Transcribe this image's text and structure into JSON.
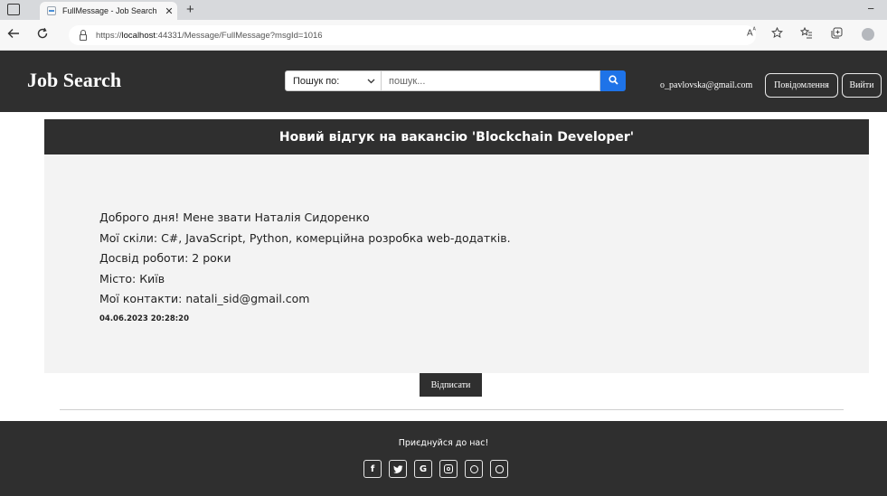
{
  "browser": {
    "tab_title": "FullMessage - Job Search",
    "tab_close": "✕",
    "new_tab": "+",
    "minimize": "−",
    "url_prefix": "https://",
    "url_host": "localhost",
    "url_rest": ":44331/Message/FullMessage?msgId=1016"
  },
  "header": {
    "brand": "Job Search",
    "search_select": "Пошук по:",
    "search_placeholder": "пошук...",
    "user_email": "o_pavlovska@gmail.com",
    "messages_button": "Повідомлення",
    "logout_button": "Вийти"
  },
  "message": {
    "title": "Новий відгук на вакансію 'Blockchain Developer'",
    "lines": [
      "Доброго дня! Мене звати Наталія Сидоренко",
      "Мої скіли: C#, JavaScript, Python, комерційна розробка web-додатків.",
      "Досвід роботи: 2 роки",
      "Місто: Київ",
      "Мої контакти: natali_sid@gmail.com"
    ],
    "date": "04.06.2023 20:28:20",
    "unsubscribe_button": "Відписати"
  },
  "footer": {
    "join_text": "Приєднуйся до нас!",
    "socials": [
      "facebook-icon",
      "twitter-icon",
      "google-icon",
      "instagram-icon",
      "whatsapp-icon",
      "skype-icon"
    ],
    "facebook_glyph": "f",
    "google_glyph": "G"
  },
  "colors": {
    "dark": "#2f2f2f",
    "card_body": "#f3f3f3",
    "search_button": "#1e73e8"
  }
}
